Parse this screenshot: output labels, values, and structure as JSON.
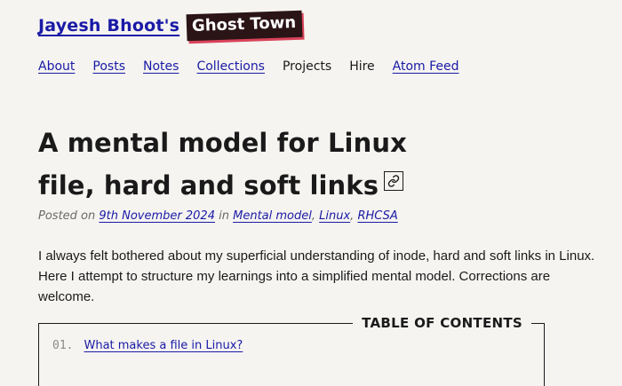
{
  "site": {
    "title": "Jayesh Bhoot's",
    "badge": "Ghost Town"
  },
  "nav": {
    "items": [
      {
        "label": "About",
        "link": true
      },
      {
        "label": "Posts",
        "link": true
      },
      {
        "label": "Notes",
        "link": true
      },
      {
        "label": "Collections",
        "link": true
      },
      {
        "label": "Projects",
        "link": false
      },
      {
        "label": "Hire",
        "link": false
      },
      {
        "label": "Atom Feed",
        "link": true
      }
    ]
  },
  "post": {
    "title": "A mental model for Linux file, hard and soft links",
    "permalink_icon": "link-icon",
    "meta": {
      "posted_on": "Posted on",
      "date": "9th November 2024",
      "in": "in",
      "tags": [
        "Mental model",
        "Linux",
        "RHCSA"
      ],
      "separator": ", "
    },
    "intro": "I always felt bothered about my superficial understanding of inode, hard and soft links in Linux. Here I attempt to structure my learnings into a simplified mental model. Corrections are welcome."
  },
  "toc": {
    "heading": "TABLE OF CONTENTS",
    "items": [
      {
        "number": "01.",
        "label": "What makes a file in Linux?"
      }
    ]
  },
  "colors": {
    "background": "#f5f4f1",
    "link": "#1a1aa6",
    "badge_bg": "#2a1416",
    "badge_shadow": "#d9435a"
  }
}
